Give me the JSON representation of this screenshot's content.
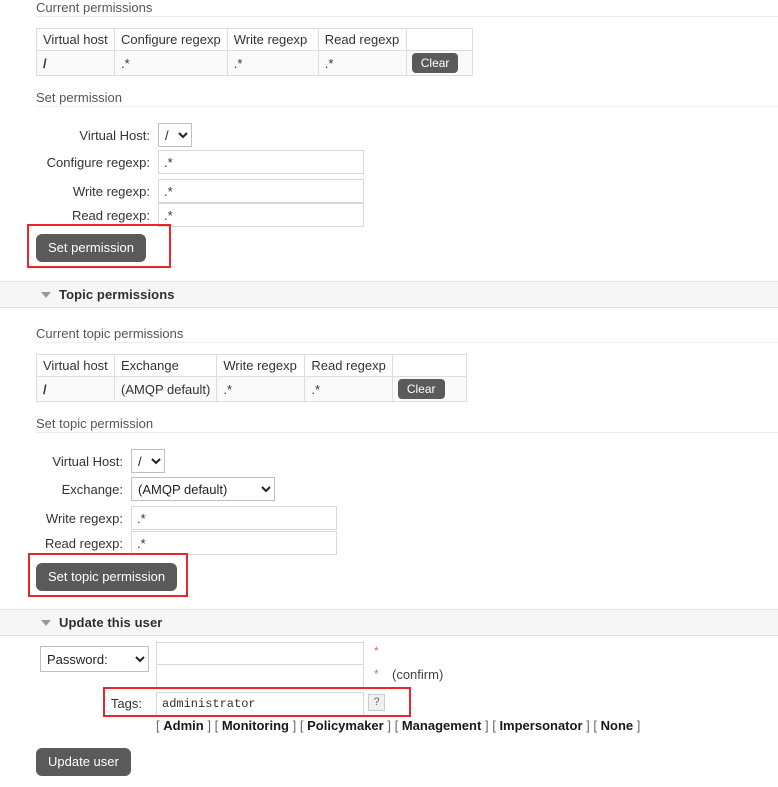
{
  "permissions": {
    "current_label": "Current permissions",
    "table": {
      "headers": [
        "Virtual host",
        "Configure regexp",
        "Write regexp",
        "Read regexp",
        ""
      ],
      "rows": [
        {
          "virtual_host": "/",
          "configure_regexp": ".*",
          "write_regexp": ".*",
          "read_regexp": ".*",
          "action": "Clear"
        }
      ]
    },
    "set_label": "Set permission",
    "form": {
      "virtual_host_label": "Virtual Host:",
      "virtual_host_value": "/",
      "configure_label": "Configure regexp:",
      "configure_value": ".*",
      "write_label": "Write regexp:",
      "write_value": ".*",
      "read_label": "Read regexp:",
      "read_value": ".*",
      "submit_label": "Set permission"
    }
  },
  "topic_permissions": {
    "section_title": "Topic permissions",
    "current_label": "Current topic permissions",
    "table": {
      "headers": [
        "Virtual host",
        "Exchange",
        "Write regexp",
        "Read regexp",
        ""
      ],
      "rows": [
        {
          "virtual_host": "/",
          "exchange": "(AMQP default)",
          "write_regexp": ".*",
          "read_regexp": ".*",
          "action": "Clear"
        }
      ]
    },
    "set_label": "Set topic permission",
    "form": {
      "virtual_host_label": "Virtual Host:",
      "virtual_host_value": "/",
      "exchange_label": "Exchange:",
      "exchange_value": "(AMQP default)",
      "write_label": "Write regexp:",
      "write_value": ".*",
      "read_label": "Read regexp:",
      "read_value": ".*",
      "submit_label": "Set topic permission"
    }
  },
  "update_user": {
    "section_title": "Update this user",
    "password_mode_label": "Password:",
    "password_value": "",
    "password_confirm_value": "",
    "required_marker": "*",
    "confirm_label": "(confirm)",
    "tags_label": "Tags:",
    "tags_value": "administrator",
    "tags_help_label": "?",
    "tag_links": [
      "Admin",
      "Monitoring",
      "Policymaker",
      "Management",
      "Impersonator",
      "None"
    ],
    "bracket_open": "[",
    "bracket_close": "]",
    "submit_label": "Update user"
  },
  "accent": {
    "annotation_red": "#e8272c",
    "button_gray": "#5a5a5a"
  }
}
